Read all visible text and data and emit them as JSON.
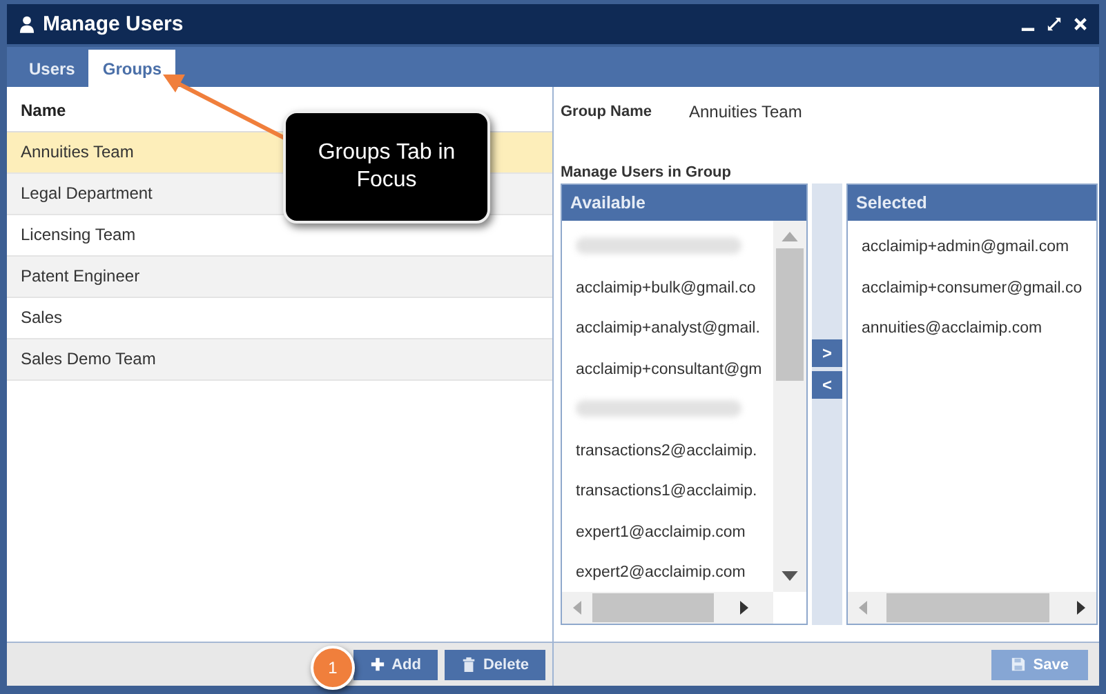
{
  "window": {
    "title": "Manage Users"
  },
  "tabs": [
    {
      "label": "Users",
      "selected": false
    },
    {
      "label": "Groups",
      "selected": true
    }
  ],
  "groups_table": {
    "column": "Name",
    "rows": [
      {
        "name": "Annuities Team",
        "selected": true
      },
      {
        "name": "Legal Department",
        "selected": false
      },
      {
        "name": "Licensing Team",
        "selected": false
      },
      {
        "name": "Patent Engineer",
        "selected": false
      },
      {
        "name": "Sales",
        "selected": false
      },
      {
        "name": "Sales Demo Team",
        "selected": false
      }
    ]
  },
  "left_buttons": [
    {
      "label": "Add",
      "kind": "add"
    },
    {
      "label": "Delete",
      "kind": "delete"
    }
  ],
  "group_name": {
    "label": "Group Name",
    "value": "Annuities Team"
  },
  "manage_title": "Manage Users in Group",
  "available": {
    "title": "Available",
    "items": [
      {
        "kind": "redacted"
      },
      {
        "kind": "email",
        "text": "acclaimip+bulk@gmail.co"
      },
      {
        "kind": "email",
        "text": "acclaimip+analyst@gmail."
      },
      {
        "kind": "email",
        "text": "acclaimip+consultant@gm"
      },
      {
        "kind": "redacted"
      },
      {
        "kind": "email",
        "text": "transactions2@acclaimip."
      },
      {
        "kind": "email",
        "text": "transactions1@acclaimip."
      },
      {
        "kind": "email",
        "text": "expert1@acclaimip.com"
      },
      {
        "kind": "email",
        "text": "expert2@acclaimip.com"
      }
    ]
  },
  "move_buttons": [
    {
      "label": ">"
    },
    {
      "label": "<"
    }
  ],
  "selected_list": {
    "title": "Selected",
    "items": [
      {
        "kind": "email",
        "text": "acclaimip+admin@gmail.com"
      },
      {
        "kind": "email",
        "text": "acclaimip+consumer@gmail.co"
      },
      {
        "kind": "email",
        "text": "annuities@acclaimip.com"
      }
    ]
  },
  "save_button": {
    "label": "Save",
    "disabled": true
  },
  "callout": {
    "text": "Groups Tab in Focus"
  },
  "step_badge": "1"
}
